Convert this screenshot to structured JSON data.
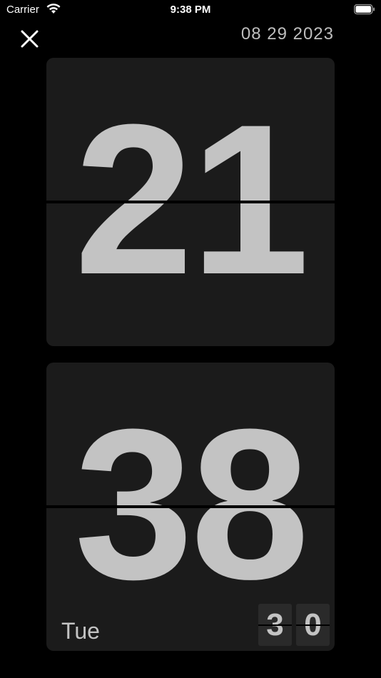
{
  "status_bar": {
    "carrier": "Carrier",
    "time": "9:38 PM",
    "wifi_icon": "wifi-icon",
    "battery_icon": "battery-icon"
  },
  "header": {
    "close_icon": "close-icon",
    "date": "08 29 2023"
  },
  "clock": {
    "hours": "21",
    "minutes": "38",
    "weekday": "Tue",
    "seconds": [
      "3",
      "0"
    ]
  },
  "colors": {
    "background": "#000000",
    "card": "#1b1b1b",
    "digit": "#c3c3c3",
    "date_text": "#bdbdbd"
  }
}
